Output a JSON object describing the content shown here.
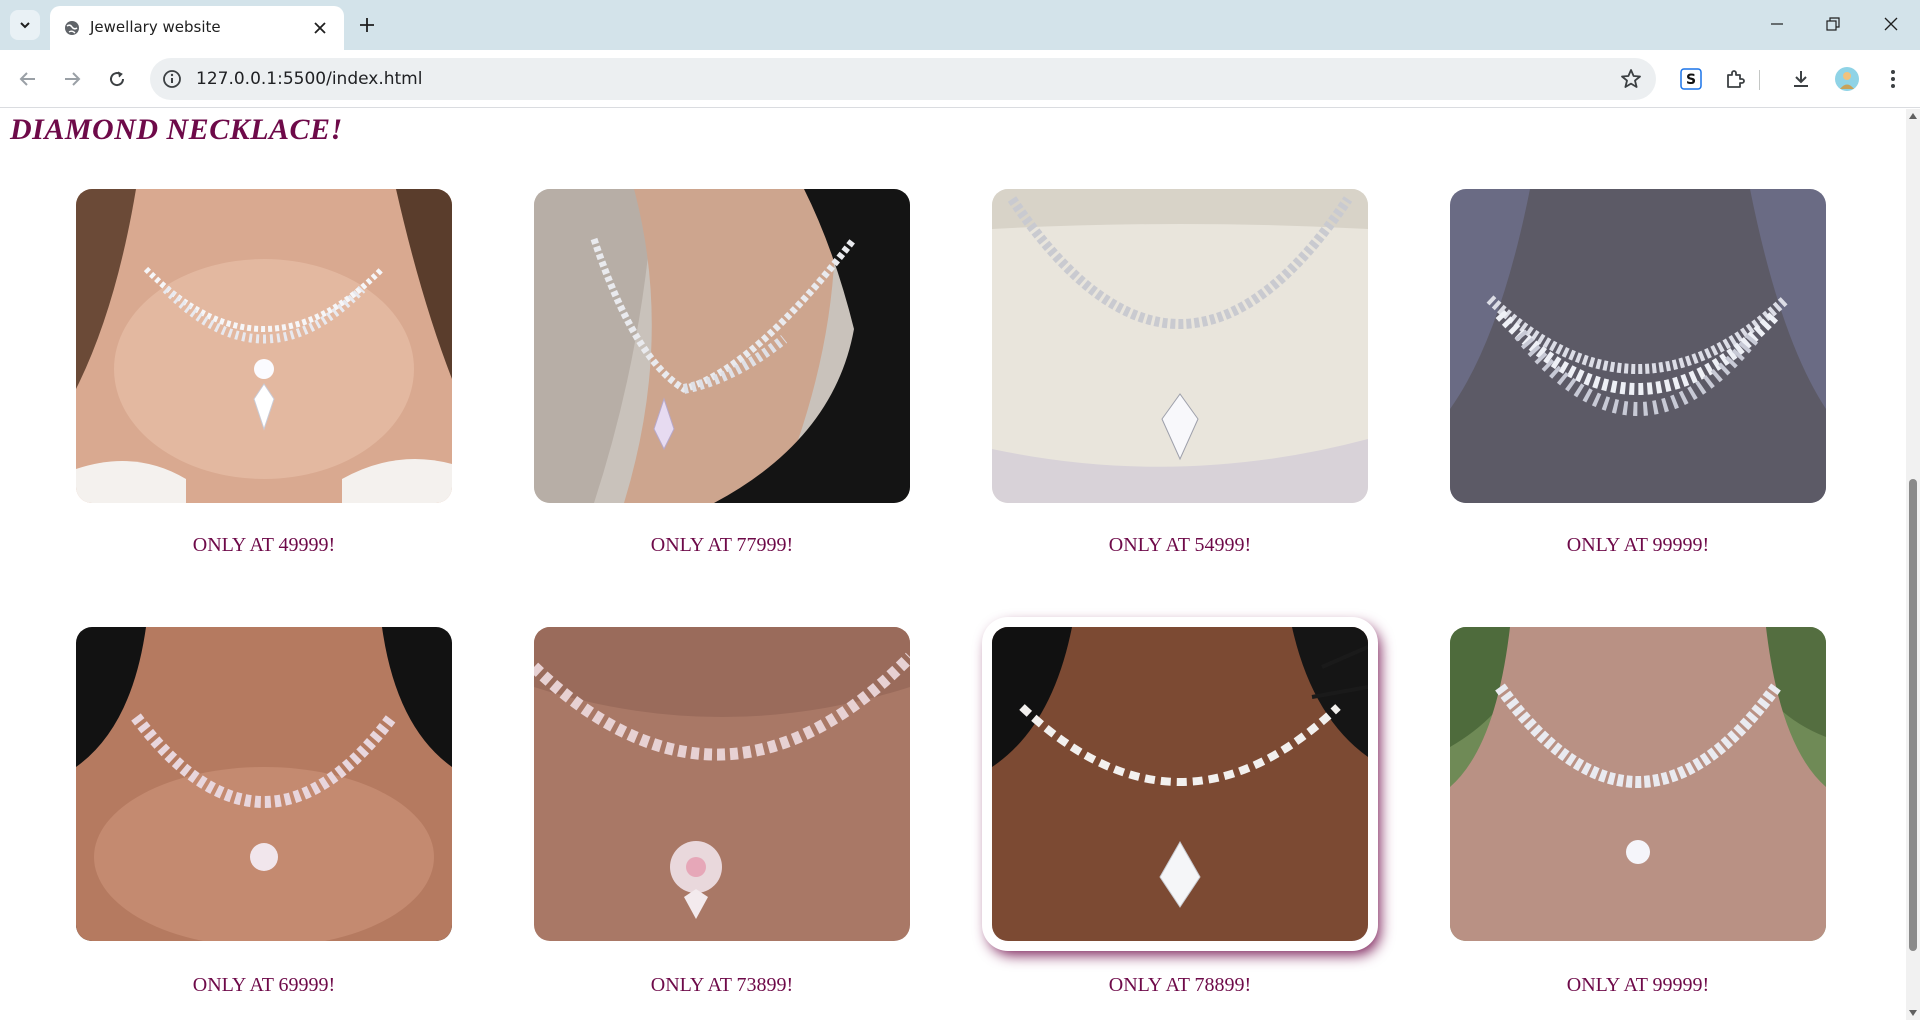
{
  "browser": {
    "tab_title": "Jewellary website",
    "url": "127.0.0.1:5500/index.html",
    "icons": {
      "tab_search": "chevron-down-icon",
      "favicon": "globe-icon",
      "tab_close": "close-icon",
      "new_tab": "plus-icon",
      "back": "arrow-left-icon",
      "forward": "arrow-right-icon",
      "reload": "reload-icon",
      "site_info": "info-icon",
      "bookmark": "star-icon",
      "extension_s": "s-extension-icon",
      "extensions": "puzzle-icon",
      "downloads": "download-icon",
      "profile": "avatar",
      "menu": "kebab-menu-icon"
    }
  },
  "page": {
    "section_title": "DIAMOND NECKLACE!",
    "accent_color": "#6e0a49",
    "products": [
      {
        "price_label": "ONLY AT 49999!",
        "image": "necklace-photo"
      },
      {
        "price_label": "ONLY AT 77999!",
        "image": "necklace-photo"
      },
      {
        "price_label": "ONLY AT 54999!",
        "image": "necklace-photo"
      },
      {
        "price_label": "ONLY AT 99999!",
        "image": "necklace-photo"
      },
      {
        "price_label": "ONLY AT 69999!",
        "image": "necklace-photo"
      },
      {
        "price_label": "ONLY AT 73899!",
        "image": "necklace-photo"
      },
      {
        "price_label": "ONLY AT 78899!",
        "image": "necklace-photo",
        "hovered": true
      },
      {
        "price_label": "ONLY AT 99999!",
        "image": "necklace-photo"
      }
    ]
  }
}
